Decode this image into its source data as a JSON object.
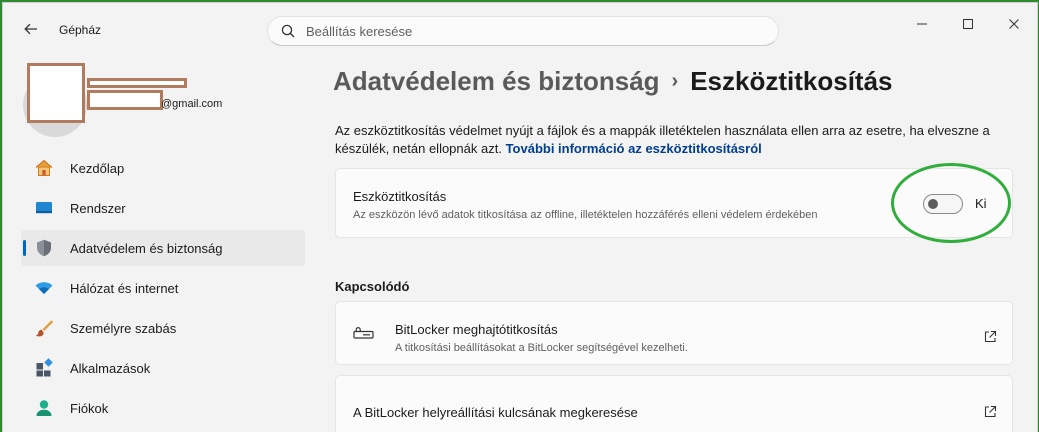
{
  "window": {
    "app_title": "Gépház",
    "back_icon": "arrow-left-icon",
    "minimize_icon": "minimize-icon",
    "maximize_icon": "maximize-icon",
    "close_icon": "close-icon"
  },
  "search": {
    "placeholder": "Beállítás keresése",
    "icon": "search-icon"
  },
  "account": {
    "email": "@gmail.com"
  },
  "sidebar": {
    "items": [
      {
        "label": "Kezdőlap",
        "icon": "home-icon",
        "active": false
      },
      {
        "label": "Rendszer",
        "icon": "system-icon",
        "active": false
      },
      {
        "label": "Adatvédelem és biztonság",
        "icon": "shield-icon",
        "active": true
      },
      {
        "label": "Hálózat és internet",
        "icon": "wifi-icon",
        "active": false
      },
      {
        "label": "Személyre szabás",
        "icon": "brush-icon",
        "active": false
      },
      {
        "label": "Alkalmazások",
        "icon": "apps-icon",
        "active": false
      },
      {
        "label": "Fiókok",
        "icon": "account-icon",
        "active": false
      }
    ]
  },
  "main": {
    "breadcrumb_parent": "Adatvédelem és biztonság",
    "breadcrumb_separator": "›",
    "page_title": "Eszköztitkosítás",
    "description": "Az eszköztitkosítás védelmet nyújt a fájlok és a mappák illetéktelen használata ellen arra az esetre, ha elveszne a készülék, netán ellopnák azt.",
    "description_link": "További információ az eszköztitkosításról",
    "encryption_card": {
      "title": "Eszköztitkosítás",
      "subtitle": "Az eszközön lévő adatok titkosítása az offline, illetéktelen hozzáférés elleni védelem érdekében",
      "toggle_state": "Ki",
      "toggle_on": false
    },
    "related_heading": "Kapcsolódó",
    "related": [
      {
        "title": "BitLocker meghajtótitkosítás",
        "subtitle": "A titkosítási beállításokat a BitLocker segítségével kezelheti.",
        "icon": "bitlocker-key-icon",
        "action_icon": "open-external-icon"
      },
      {
        "title": "A BitLocker helyreállítási kulcsának megkeresése",
        "action_icon": "open-external-icon"
      }
    ]
  },
  "colors": {
    "accent": "#0067c0",
    "annotation": "#2fae3b",
    "frame": "#2f8a2f"
  }
}
